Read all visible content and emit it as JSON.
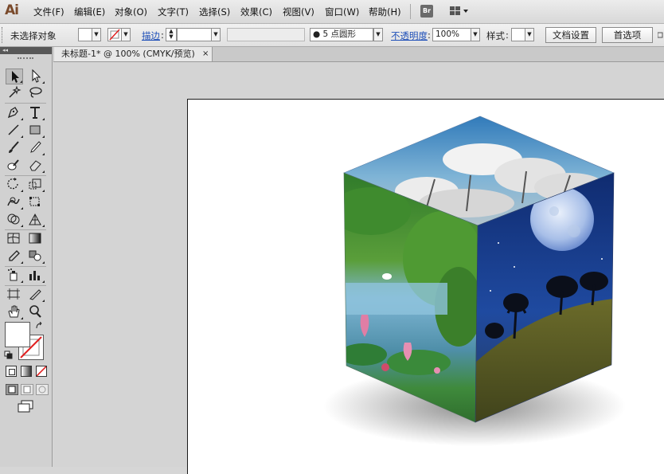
{
  "app": {
    "logo": "Ai"
  },
  "menus": [
    "文件(F)",
    "编辑(E)",
    "对象(O)",
    "文字(T)",
    "选择(S)",
    "效果(C)",
    "视图(V)",
    "窗口(W)",
    "帮助(H)"
  ],
  "bridge_badge": "Br",
  "workspace_icon": "grid-icon",
  "control": {
    "selection_status": "未选择对象",
    "stroke_label": "描边",
    "brush_value": "5 点圆形",
    "opacity_label": "不透明度",
    "opacity_value": "100%",
    "style_label": "样式",
    "doc_setup": "文档设置",
    "preferences": "首选项"
  },
  "document": {
    "tab_title": "未标题-1* @ 100% (CMYK/预览)",
    "close": "×"
  },
  "colors": {
    "fill": "#ffffff",
    "stroke": "none",
    "none_slash": "#e02020"
  },
  "tools": [
    "selection-tool",
    "direct-selection-tool",
    "magic-wand-tool",
    "lasso-tool",
    "pen-tool",
    "type-tool",
    "line-tool",
    "rectangle-tool",
    "paintbrush-tool",
    "pencil-tool",
    "blob-brush-tool",
    "eraser-tool",
    "rotate-tool",
    "scale-tool",
    "warp-tool",
    "free-transform-tool",
    "shape-builder-tool",
    "perspective-grid-tool",
    "mesh-tool",
    "gradient-tool",
    "eyedropper-tool",
    "blend-tool",
    "symbol-sprayer-tool",
    "column-graph-tool",
    "artboard-tool",
    "slice-tool",
    "hand-tool",
    "zoom-tool"
  ]
}
